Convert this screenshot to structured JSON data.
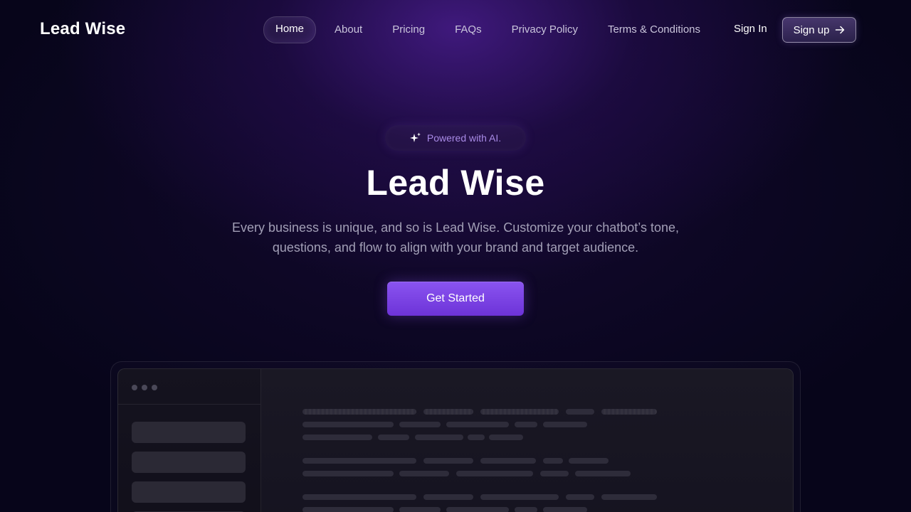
{
  "brand": {
    "name": "Lead Wise"
  },
  "nav": {
    "items": [
      {
        "label": "Home",
        "active": true
      },
      {
        "label": "About",
        "active": false
      },
      {
        "label": "Pricing",
        "active": false
      },
      {
        "label": "FAQs",
        "active": false
      },
      {
        "label": "Privacy Policy",
        "active": false
      },
      {
        "label": "Terms & Conditions",
        "active": false
      }
    ]
  },
  "auth": {
    "sign_in": "Sign In",
    "sign_up": "Sign up"
  },
  "hero": {
    "badge_icon": "sparkle-icon",
    "badge": "Powered with AI.",
    "title": "Lead Wise",
    "description": "Every business is unique, and so is Lead Wise. Customize your chatbot’s tone, questions, and flow to align with your brand and target audience.",
    "cta": "Get Started"
  },
  "colors": {
    "background": "#07051a",
    "accent": "#7c44e6",
    "badge_text": "#a88ae6",
    "muted_text": "#a29fb6"
  }
}
